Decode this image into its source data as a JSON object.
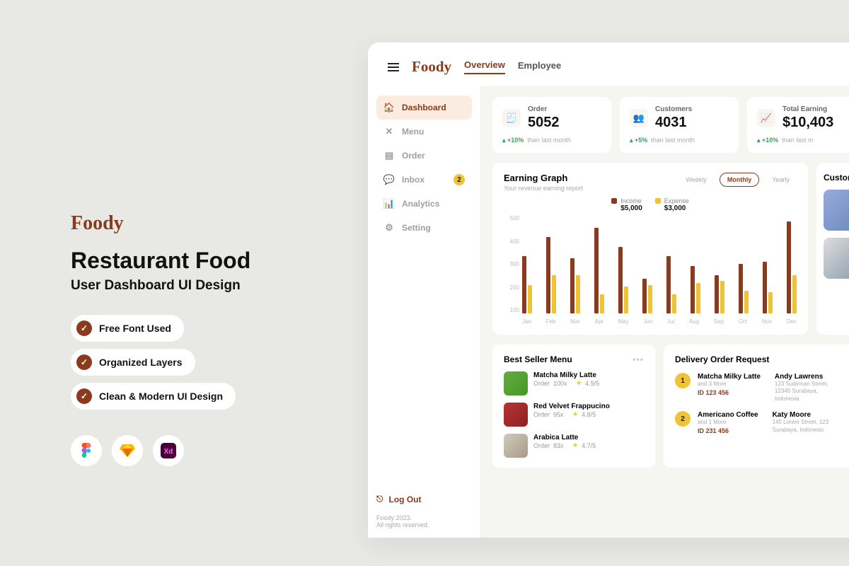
{
  "promo": {
    "logo": "Foody",
    "title": "Restaurant Food",
    "subtitle": "User Dashboard UI Design",
    "features": [
      "Free Font Used",
      "Organized Layers",
      "Clean & Modern UI Design"
    ],
    "tools": [
      "figma",
      "sketch",
      "xd"
    ]
  },
  "topbar": {
    "logo": "Foody",
    "tabs": [
      "Overview",
      "Employee"
    ],
    "active_tab": 0
  },
  "sidebar": {
    "items": [
      {
        "icon": "home",
        "label": "Dashboard"
      },
      {
        "icon": "utensils",
        "label": "Menu"
      },
      {
        "icon": "doc",
        "label": "Order"
      },
      {
        "icon": "chat",
        "label": "Inbox",
        "badge": "2"
      },
      {
        "icon": "bars",
        "label": "Analytics"
      },
      {
        "icon": "gear",
        "label": "Setting"
      }
    ],
    "active": 0,
    "logout": "Log Out",
    "copyright1": "Foody 2023.",
    "copyright2": "All rights reserved."
  },
  "stats": [
    {
      "icon": "order",
      "label": "Order",
      "value": "5052",
      "change": "+10%",
      "suffix": "than last month"
    },
    {
      "icon": "customers",
      "label": "Customers",
      "value": "4031",
      "change": "+5%",
      "suffix": "than last month"
    },
    {
      "icon": "earning",
      "label": "Total Earning",
      "value": "$10,403",
      "change": "+10%",
      "suffix": "than last m"
    }
  ],
  "earning_graph": {
    "title": "Earning Graph",
    "subtitle": "Your revenue earning report",
    "period_tabs": [
      "Weekly",
      "Monthly",
      "Yearly"
    ],
    "active_period": 1,
    "legend": [
      {
        "label": "Income",
        "value": "$5,000",
        "color": "#8b3a1e"
      },
      {
        "label": "Expense",
        "value": "$3,000",
        "color": "#f1c232"
      }
    ]
  },
  "chart_data": {
    "type": "bar",
    "categories": [
      "Jan",
      "Feb",
      "Mar",
      "Apr",
      "May",
      "Jun",
      "Jul",
      "Aug",
      "Sep",
      "Oct",
      "Nov",
      "Dec"
    ],
    "series": [
      {
        "name": "Income",
        "color": "#8b3a1e",
        "values": [
          300,
          400,
          290,
          450,
          350,
          180,
          300,
          250,
          200,
          260,
          270,
          480
        ]
      },
      {
        "name": "Expense",
        "color": "#f1c232",
        "values": [
          150,
          200,
          200,
          100,
          140,
          150,
          100,
          160,
          170,
          120,
          110,
          200
        ]
      }
    ],
    "ylim": [
      0,
      500
    ],
    "yticks": [
      100,
      200,
      300,
      400,
      500
    ],
    "xlabel": "",
    "ylabel": "",
    "title": "Earning Graph"
  },
  "customer_card": {
    "title": "Custor"
  },
  "best_seller": {
    "title": "Best Seller Menu",
    "items": [
      {
        "name": "Matcha Milky Latte",
        "order_label": "Order",
        "qty": "100x",
        "rating": "4.9/5",
        "img": "matcha"
      },
      {
        "name": "Red Velvet Frappucino",
        "order_label": "Order",
        "qty": "95x",
        "rating": "4.8/5",
        "img": "rv"
      },
      {
        "name": "Arabica Latte",
        "order_label": "Order",
        "qty": "83x",
        "rating": "4.7/5",
        "img": "al"
      }
    ]
  },
  "delivery": {
    "title": "Delivery Order Request",
    "items": [
      {
        "num": "1",
        "name": "Matcha Milky Latte",
        "more": "and 3 More",
        "id": "ID 123 456",
        "customer": "Andy Lawrens",
        "addr": "123 Sudirman Street,\n12345 Surabaya,\nIndonesia"
      },
      {
        "num": "2",
        "name": "Americano Coffee",
        "more": "and 1 More",
        "id": "ID 231 456",
        "customer": "Katy Moore",
        "addr": "145 Lorem Street, 123\nSurabaya, Indonesic"
      }
    ]
  }
}
